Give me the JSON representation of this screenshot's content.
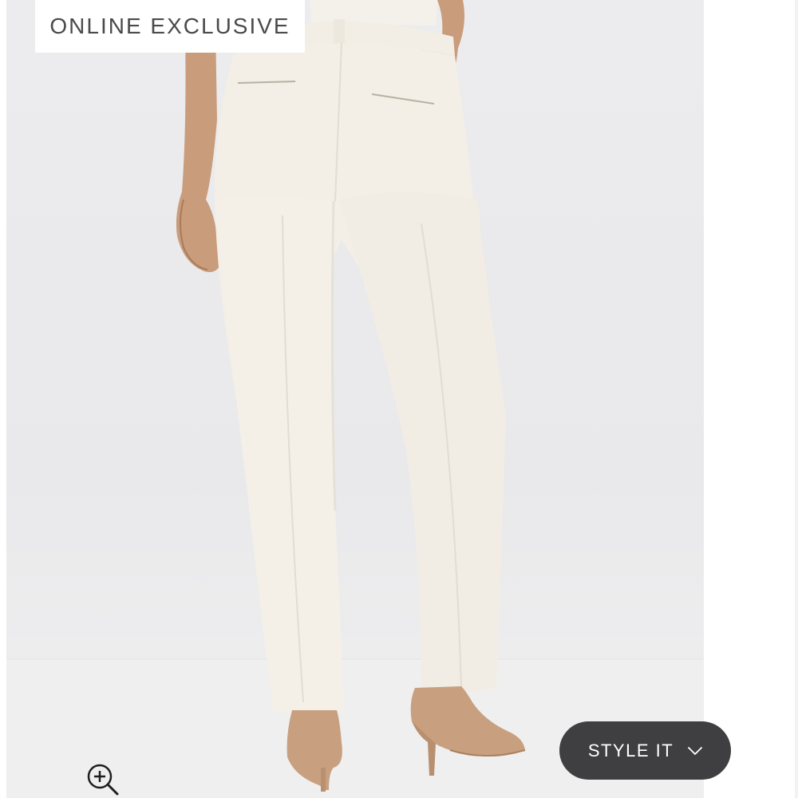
{
  "badge": {
    "label": "ONLINE EXCLUSIVE"
  },
  "product_image": {
    "subject": "ivory straight-leg trousers, back view, tan suede heels"
  },
  "style_button": {
    "label": "STYLE IT",
    "icon": "chevron-down-icon"
  },
  "zoom": {
    "icon": "zoom-in-icon"
  },
  "colors": {
    "badge_text": "#4a4a4a",
    "button_bg": "#3f3f42",
    "button_text": "#ffffff",
    "backdrop": "#ebebed",
    "trousers": "#f3efe6",
    "heels": "#c9a07f"
  }
}
